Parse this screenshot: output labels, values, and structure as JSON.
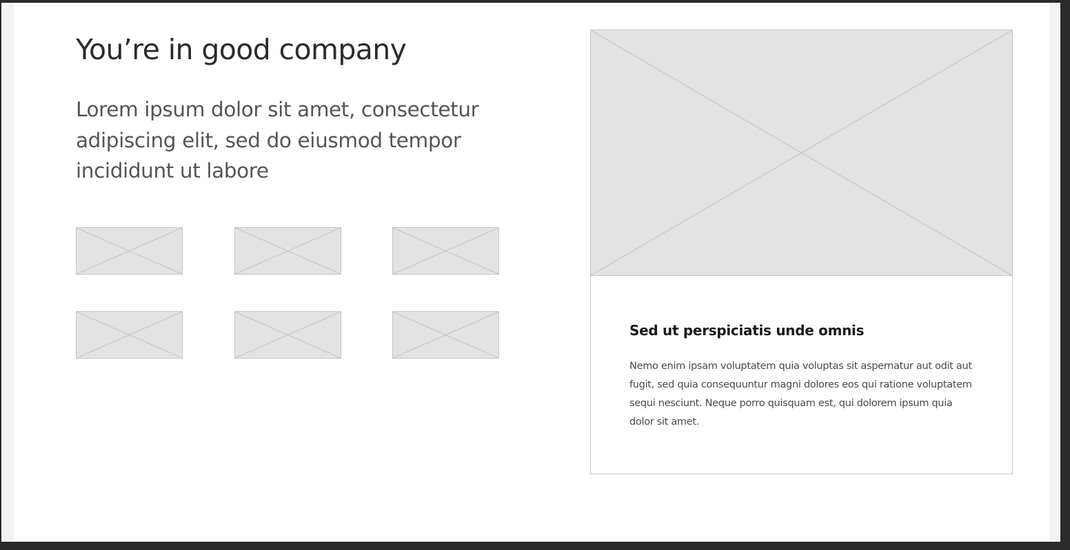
{
  "section": {
    "heading": "You’re in good company",
    "lead": "Lorem ipsum dolor sit amet, consectetur adipiscing elit, sed do eiusmod tempor incididunt ut labore"
  },
  "logo_grid": {
    "items": [
      "image-placeholder",
      "image-placeholder",
      "image-placeholder",
      "image-placeholder",
      "image-placeholder",
      "image-placeholder"
    ]
  },
  "card": {
    "image": "image-placeholder",
    "title": "Sed ut perspiciatis unde omnis",
    "body": "Nemo enim ipsam voluptatem quia voluptas sit aspernatur aut odit aut fugit, sed quia consequuntur magni dolores eos qui ratione voluptatem sequi nesciunt. Neque porro quisquam est, qui dolorem ipsum quia dolor sit amet."
  },
  "colors": {
    "placeholder_fill": "#e3e3e3",
    "placeholder_stroke": "#c4c4c4",
    "heading_text": "#2b2b2b",
    "body_text": "#555555",
    "frame": "#2a2a2a"
  }
}
